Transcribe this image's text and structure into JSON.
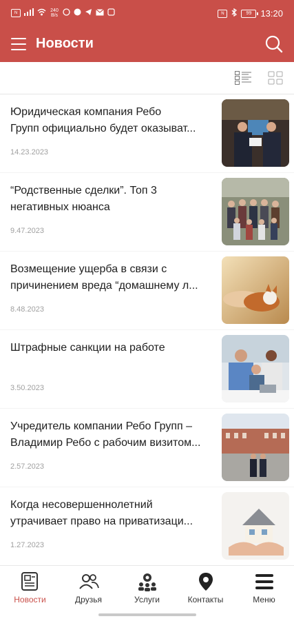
{
  "status_bar": {
    "network_icons": [
      "nfc-icon",
      "signal-icon",
      "wifi-icon"
    ],
    "speed": "240 B/s",
    "app_icons": [
      "whatsapp-icon",
      "viber-icon",
      "telegram-icon",
      "gmail-icon",
      "hangouts-icon"
    ],
    "nfc": "N",
    "bluetooth": "bluetooth-icon",
    "battery": "99",
    "time": "13:20"
  },
  "header": {
    "title": "Новости",
    "menu_icon": "hamburger-icon",
    "search_icon": "search-icon",
    "accent_color": "#c94f49"
  },
  "view_toggle": {
    "list_icon": "list-view-icon",
    "grid_icon": "grid-view-icon"
  },
  "news": [
    {
      "title_line1": "Юридическая компания Ребо",
      "title_line2": "Групп официально будет оказыват...",
      "date": "14.23.2023",
      "image": "business-meeting-photo"
    },
    {
      "title_line1": "“Родственные сделки”. Топ 3",
      "title_line2": "негативных нюанса",
      "date": "9.47.2023",
      "image": "family-group-photo"
    },
    {
      "title_line1": "Возмещение ущерба в связи с",
      "title_line2": "причинением вреда “домашнему л...",
      "date": "8.48.2023",
      "image": "pet-dog-photo"
    },
    {
      "title_line1": "Штрафные санкции на работе",
      "title_line2": "",
      "date": "3.50.2023",
      "image": "office-team-photo"
    },
    {
      "title_line1": "Учредитель компании Ребо Групп –",
      "title_line2": "Владимир Ребо с рабочим визитом...",
      "date": "2.57.2023",
      "image": "city-square-photo"
    },
    {
      "title_line1": "Когда несовершеннолетний",
      "title_line2": "утрачивает право на приватизаци...",
      "date": "1.27.2023",
      "image": "house-in-hands-photo"
    }
  ],
  "bottom_nav": [
    {
      "label": "Новости",
      "icon": "news-icon",
      "active": true
    },
    {
      "label": "Друзья",
      "icon": "friends-icon",
      "active": false
    },
    {
      "label": "Услуги",
      "icon": "services-icon",
      "active": false
    },
    {
      "label": "Контакты",
      "icon": "location-pin-icon",
      "active": false
    },
    {
      "label": "Меню",
      "icon": "menu-icon",
      "active": false
    }
  ]
}
